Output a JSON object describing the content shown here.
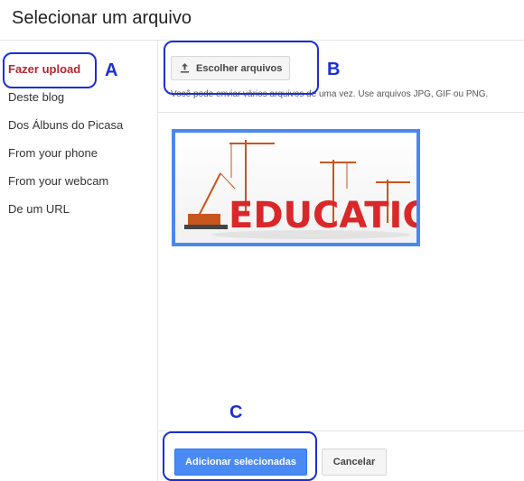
{
  "dialog": {
    "title": "Selecionar um arquivo"
  },
  "sidebar": {
    "items": [
      {
        "label": "Fazer upload",
        "active": true
      },
      {
        "label": "Deste blog",
        "active": false
      },
      {
        "label": "Dos Álbuns do Picasa",
        "active": false
      },
      {
        "label": "From your phone",
        "active": false
      },
      {
        "label": "From your webcam",
        "active": false
      },
      {
        "label": "De um URL",
        "active": false
      }
    ]
  },
  "upload": {
    "button_label": "Escolher arquivos",
    "hint": "Você pode enviar vários arquivos de uma vez. Use arquivos JPG, GIF ou PNG."
  },
  "thumbnail": {
    "text": "EDUCATION"
  },
  "footer": {
    "primary_label": "Adicionar selecionadas",
    "secondary_label": "Cancelar"
  },
  "annotations": {
    "a": "A",
    "b": "B",
    "c": "C"
  },
  "colors": {
    "accent": "#4a87ee",
    "primary_button": "#4a8af4",
    "active_item": "#b3262e",
    "annotation": "#1a2fd4"
  }
}
